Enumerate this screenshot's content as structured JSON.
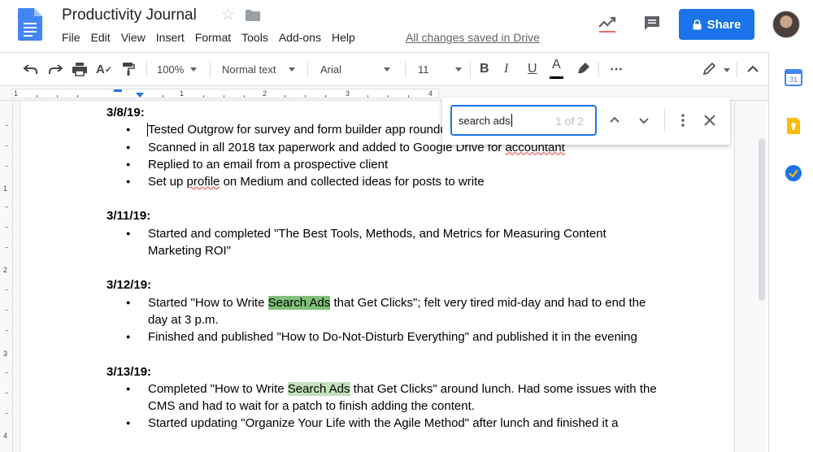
{
  "header": {
    "title": "Productivity Journal",
    "menu": [
      "File",
      "Edit",
      "View",
      "Insert",
      "Format",
      "Tools",
      "Add-ons",
      "Help"
    ],
    "saved_status": "All changes saved in Drive",
    "share_label": "Share"
  },
  "toolbar": {
    "zoom": "100%",
    "style": "Normal text",
    "font": "Arial",
    "font_size": "11",
    "bold": "B",
    "italic": "I",
    "underline": "U",
    "text_color": "A",
    "more": "⋯"
  },
  "ruler": {
    "h_numbers": [
      "1",
      "1",
      "2",
      "3",
      "4"
    ],
    "v_numbers": [
      "1",
      "2",
      "3",
      "4"
    ]
  },
  "find": {
    "query": "search ads",
    "count": "1 of 2"
  },
  "document": {
    "entries": [
      {
        "date": "3/8/19:",
        "items": [
          "Tested Outgrow for survey and form builder app roundup",
          "Scanned in all 2018 tax paperwork and added to Google Drive for accountant",
          "Replied to an email from a prospective client",
          "Set up profile on Medium and collected ideas for posts to write"
        ]
      },
      {
        "date": "3/11/19:",
        "items": [
          "Started and completed \"The Best Tools, Methods, and Metrics for Measuring Content Marketing ROI\""
        ]
      },
      {
        "date": "3/12/19:",
        "items": [
          "Started \"How to Write Search Ads that Get Clicks\"; felt very tired mid-day and had to end the day at 3 p.m.",
          "Finished and published \"How to Do-Not-Disturb Everything\" and published it in the evening"
        ]
      },
      {
        "date": "3/13/19:",
        "items": [
          "Completed \"How to Write Search Ads that Get Clicks\" around lunch. Had some issues with the CMS and had to wait for a patch to finish adding the content.",
          "Started updating \"Organize Your Life with the Agile Method\" after lunch and finished it a"
        ]
      }
    ]
  },
  "colors": {
    "accent": "#1a73e8",
    "highlight_current": "#7fc17a",
    "highlight_other": "#c3e0bc"
  }
}
